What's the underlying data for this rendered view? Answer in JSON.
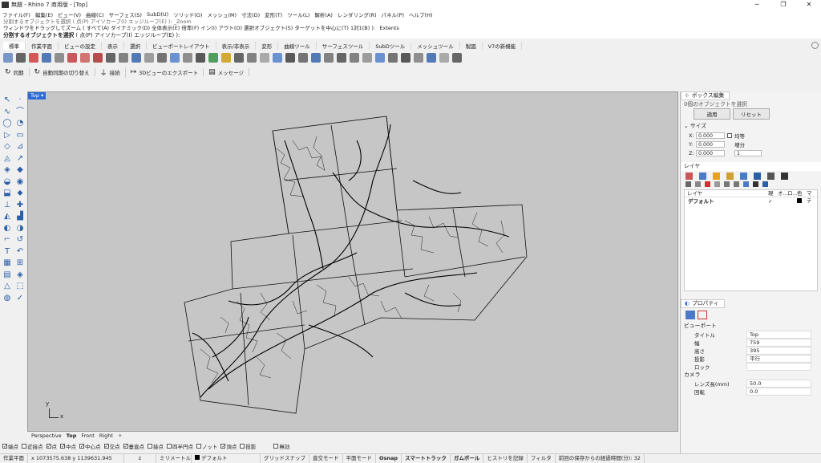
{
  "window": {
    "title": "無題 - Rhino 7 商用版 - [Top]",
    "minimize": "─",
    "maximize": "❐",
    "close": "✕"
  },
  "menu": [
    "ファイル(F)",
    "編集(E)",
    "ビュー(V)",
    "曲線(C)",
    "サーフェス(S)",
    "SubD(U)",
    "ソリッド(O)",
    "メッシュ(M)",
    "寸法(D)",
    "変形(T)",
    "ツール(L)",
    "解析(A)",
    "レンダリング(R)",
    "パネル(P)",
    "ヘルプ(H)"
  ],
  "command": {
    "history1": "分割するオブジェクトを選択 ( 点(P) アイソカーブ(I) エッジループ(E) ): _Zoom",
    "history2": "ウィンドウをドラッグしてズーム ( すべて(A) ダイナミック(D) 全体表示(E) 倍率(F) イン(I) アウト(O) 選択オブジェクト(S) ターゲットを中心に(T) 1対1(B) ): _Extents",
    "prompt": "分割するオブジェクトを選択",
    "prompt_options": " ( 点(P) アイソカーブ(I) エッジループ(E) ): "
  },
  "toolbar_tabs": [
    "標準",
    "作業平面",
    "ビューの設定",
    "表示",
    "選択",
    "ビューポートレイアウト",
    "表示/非表示",
    "変形",
    "曲線ツール",
    "サーフェスツール",
    "SubDツール",
    "メッシュツール",
    "製図",
    "V7の新機能"
  ],
  "action_bar": [
    {
      "icon": "↻",
      "label": "同期"
    },
    {
      "icon": "↻",
      "label": "自動同期の切り替え"
    },
    {
      "icon": "⏚",
      "label": "接続"
    },
    {
      "icon": "↦",
      "label": "3Dビューのエクスポート"
    },
    {
      "icon": "▤",
      "label": "メッセージ"
    }
  ],
  "viewport": {
    "label": "Top",
    "axis_x": "x",
    "axis_y": "y"
  },
  "view_tabs": [
    "Perspective",
    "Top",
    "Front",
    "Right",
    "✧"
  ],
  "osnaps": [
    {
      "label": "端点",
      "checked": true
    },
    {
      "label": "近接点",
      "checked": false
    },
    {
      "label": "点",
      "checked": true
    },
    {
      "label": "中点",
      "checked": true
    },
    {
      "label": "中心点",
      "checked": true
    },
    {
      "label": "交点",
      "checked": true
    },
    {
      "label": "垂直点",
      "checked": true
    },
    {
      "label": "接点",
      "checked": false
    },
    {
      "label": "四半円点",
      "checked": false
    },
    {
      "label": "ノット",
      "checked": false
    },
    {
      "label": "頂点",
      "checked": true
    },
    {
      "label": "投影",
      "checked": false
    },
    {
      "label": "無効",
      "checked": false
    }
  ],
  "status": {
    "cplane": "作業平面",
    "coords": "x 1073575.638  y 1139631.945",
    "z": "z",
    "units": "ミリメートル",
    "layer": "デフォルト",
    "grid_snap": "グリッドスナップ",
    "ortho": "直交モード",
    "planar": "平面モード",
    "osnap": "Osnap",
    "smarttrack": "スマートトラック",
    "gumball": "ガムボール",
    "history": "ヒストリを記録",
    "filter": "フィルタ",
    "autosave": "前回の保存からの経過時間(分): 32"
  },
  "boxedit": {
    "title": "ボックス編集",
    "selection": "0個のオブジェクトを選択",
    "apply": "適用",
    "reset": "リセット",
    "size_label": "サイズ",
    "x": "0.000",
    "y": "0.000",
    "z": "0.000",
    "uniform": "均等",
    "increment_label": "増分",
    "increment": "1"
  },
  "layers": {
    "title": "レイヤ",
    "col_name": "レイヤ",
    "col_current": "現",
    "col_on": "オ...",
    "col_lock": "ロ...",
    "col_color": "色",
    "col_mat": "マテ",
    "row_name": "デフォルト",
    "row_current": "✓"
  },
  "properties": {
    "title": "プロパティ",
    "section_viewport": "ビューポート",
    "rows": [
      {
        "label": "タイトル",
        "value": "Top"
      },
      {
        "label": "幅",
        "value": "759"
      },
      {
        "label": "高さ",
        "value": "395"
      },
      {
        "label": "投影",
        "value": "平行"
      },
      {
        "label": "ロック",
        "value": ""
      }
    ],
    "section_camera": "カメラ",
    "cam_rows": [
      {
        "label": "レンズ長(mm)",
        "value": "50.0"
      },
      {
        "label": "回転",
        "value": "0.0"
      }
    ]
  },
  "colors": {
    "accent": "#2d6ad6",
    "viewport_bg": "#c6c6c6"
  }
}
